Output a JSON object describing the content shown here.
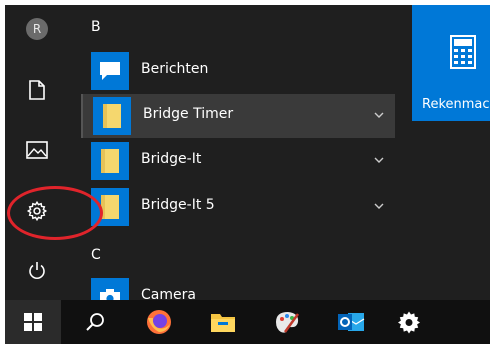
{
  "user": {
    "avatar_initial": "R"
  },
  "sections": [
    {
      "letter": "B"
    },
    {
      "letter": "C"
    }
  ],
  "apps": [
    {
      "label": "Berichten",
      "icon": "message-icon",
      "icon_bg": "#0078d7",
      "has_chevron": false,
      "selected": false
    },
    {
      "label": "Bridge Timer",
      "icon": "folder-icon",
      "icon_bg": "#0078d7",
      "has_chevron": true,
      "selected": true
    },
    {
      "label": "Bridge-It",
      "icon": "folder-icon",
      "icon_bg": "#0078d7",
      "has_chevron": true,
      "selected": false
    },
    {
      "label": "Bridge-It 5",
      "icon": "folder-icon",
      "icon_bg": "#0078d7",
      "has_chevron": true,
      "selected": false
    },
    {
      "label": "Camera",
      "icon": "camera-icon",
      "icon_bg": "#0078d7",
      "has_chevron": false,
      "selected": false
    }
  ],
  "live_tile": {
    "label": "Rekenmachine",
    "color": "#0078d7"
  },
  "rail": [
    "user-avatar",
    "documents-icon",
    "pictures-icon",
    "settings-icon",
    "power-icon"
  ],
  "taskbar": [
    "windows-start-icon",
    "search-icon",
    "firefox-icon",
    "file-explorer-icon",
    "paint-icon",
    "outlook-icon",
    "settings-icon"
  ],
  "colors": {
    "background": "#1f1f1f",
    "taskbar": "#101010",
    "accent": "#0078d7",
    "annotation": "#e0242b",
    "folder": "#f5d76e"
  }
}
